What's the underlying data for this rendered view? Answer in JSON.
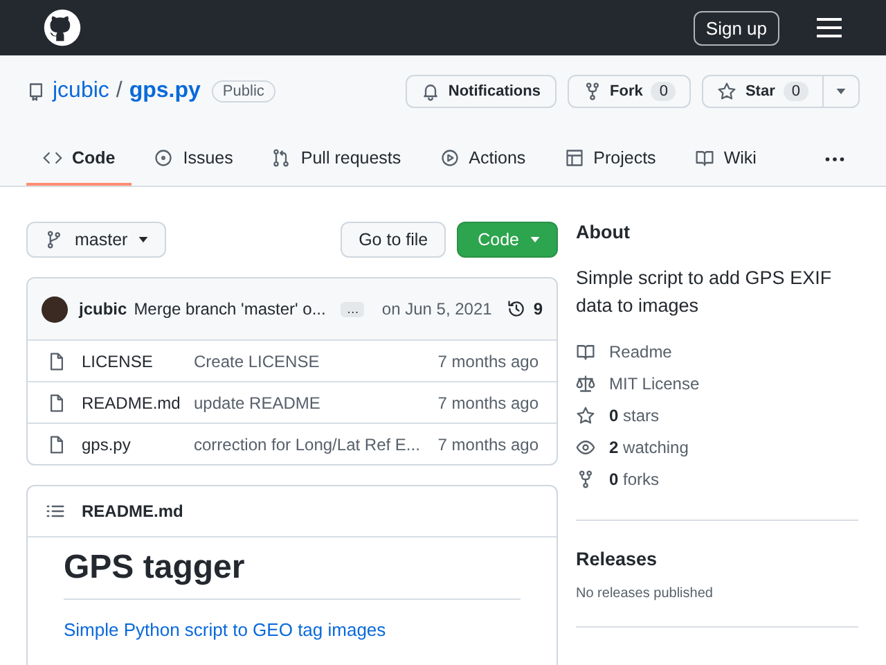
{
  "header": {
    "sign_up": "Sign up"
  },
  "repo": {
    "owner": "jcubic",
    "separator": "/",
    "name": "gps.py",
    "visibility": "Public",
    "actions": [
      {
        "label": "Notifications"
      },
      {
        "label": "Fork",
        "count": "0"
      },
      {
        "label": "Star",
        "count": "0"
      }
    ]
  },
  "tabs": [
    {
      "label": "Code",
      "selected": true
    },
    {
      "label": "Issues",
      "selected": false
    },
    {
      "label": "Pull requests",
      "selected": false
    },
    {
      "label": "Actions",
      "selected": false
    },
    {
      "label": "Projects",
      "selected": false
    },
    {
      "label": "Wiki",
      "selected": false
    }
  ],
  "toolbar": {
    "branch": "master",
    "go_to_file": "Go to file",
    "code": "Code"
  },
  "commit": {
    "author": "jcubic",
    "message": "Merge branch 'master' o...",
    "more": "…",
    "date": "on Jun 5, 2021",
    "commits": "9"
  },
  "files": [
    {
      "name": "LICENSE",
      "message": "Create LICENSE",
      "age": "7 months ago"
    },
    {
      "name": "README.md",
      "message": "update README",
      "age": "7 months ago"
    },
    {
      "name": "gps.py",
      "message": "correction for Long/Lat Ref E...",
      "age": "7 months ago"
    }
  ],
  "readme": {
    "filename": "README.md",
    "heading": "GPS tagger",
    "link": "Simple Python script to GEO tag images"
  },
  "about": {
    "title": "About",
    "description": "Simple script to add GPS EXIF data to images",
    "items": [
      {
        "label": "Readme"
      },
      {
        "label": "MIT License"
      },
      {
        "count": "0",
        "label": "stars"
      },
      {
        "count": "2",
        "label": "watching"
      },
      {
        "count": "0",
        "label": "forks"
      }
    ]
  },
  "releases": {
    "title": "Releases",
    "text": "No releases published"
  }
}
